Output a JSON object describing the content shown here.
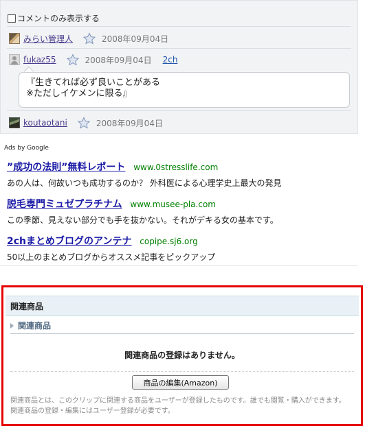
{
  "comments": {
    "comment_only_label": "コメントのみ表示する",
    "items": [
      {
        "user": "みらい管理人",
        "date": "2008年09月04日",
        "avatar": "user-photo-icon"
      },
      {
        "user": "fukaz55",
        "date": "2008年09月04日",
        "source": "2ch",
        "avatar": "default-user-icon",
        "text_line1": "『生きてれば必ず良いことがある",
        "text_line2": "※ただしイケメンに限る』"
      },
      {
        "user": "koutaotani",
        "date": "2008年09月04日",
        "avatar": "user-photo-icon"
      }
    ]
  },
  "ads": {
    "label": "Ads by Google",
    "items": [
      {
        "title": "”成功の法則”無料レポート",
        "url": "www.0stresslife.com",
        "desc": "あの人は、何故いつも成功するのか？ 外科医による心理学史上最大の発見"
      },
      {
        "title": "脱毛専門ミュゼプラチナム",
        "url": "www.musee-pla.com",
        "desc": "この季節、見えない部分でも手を抜かない。それがデキる女の基本です。"
      },
      {
        "title": "2chまとめブログのアンテナ",
        "url": "copipe.sj6.org",
        "desc": "50以上のまとめブログからオススメ記事をピックアップ"
      }
    ]
  },
  "related": {
    "header": "関連商品",
    "subheader": "関連商品",
    "empty_message": "関連商品の登録はありません。",
    "edit_button": "商品の編集(Amazon)",
    "note_line1": "関連商品とは、このクリップに関連する商品をユーザーが登録したものです。誰でも閲覧・購入ができます。",
    "note_line2": "関連商品の登録・編集にはユーザー登録が必要です。"
  },
  "colors": {
    "highlight_border": "#e60000",
    "ad_title": "#1a1aa6",
    "ad_url": "#008000"
  }
}
